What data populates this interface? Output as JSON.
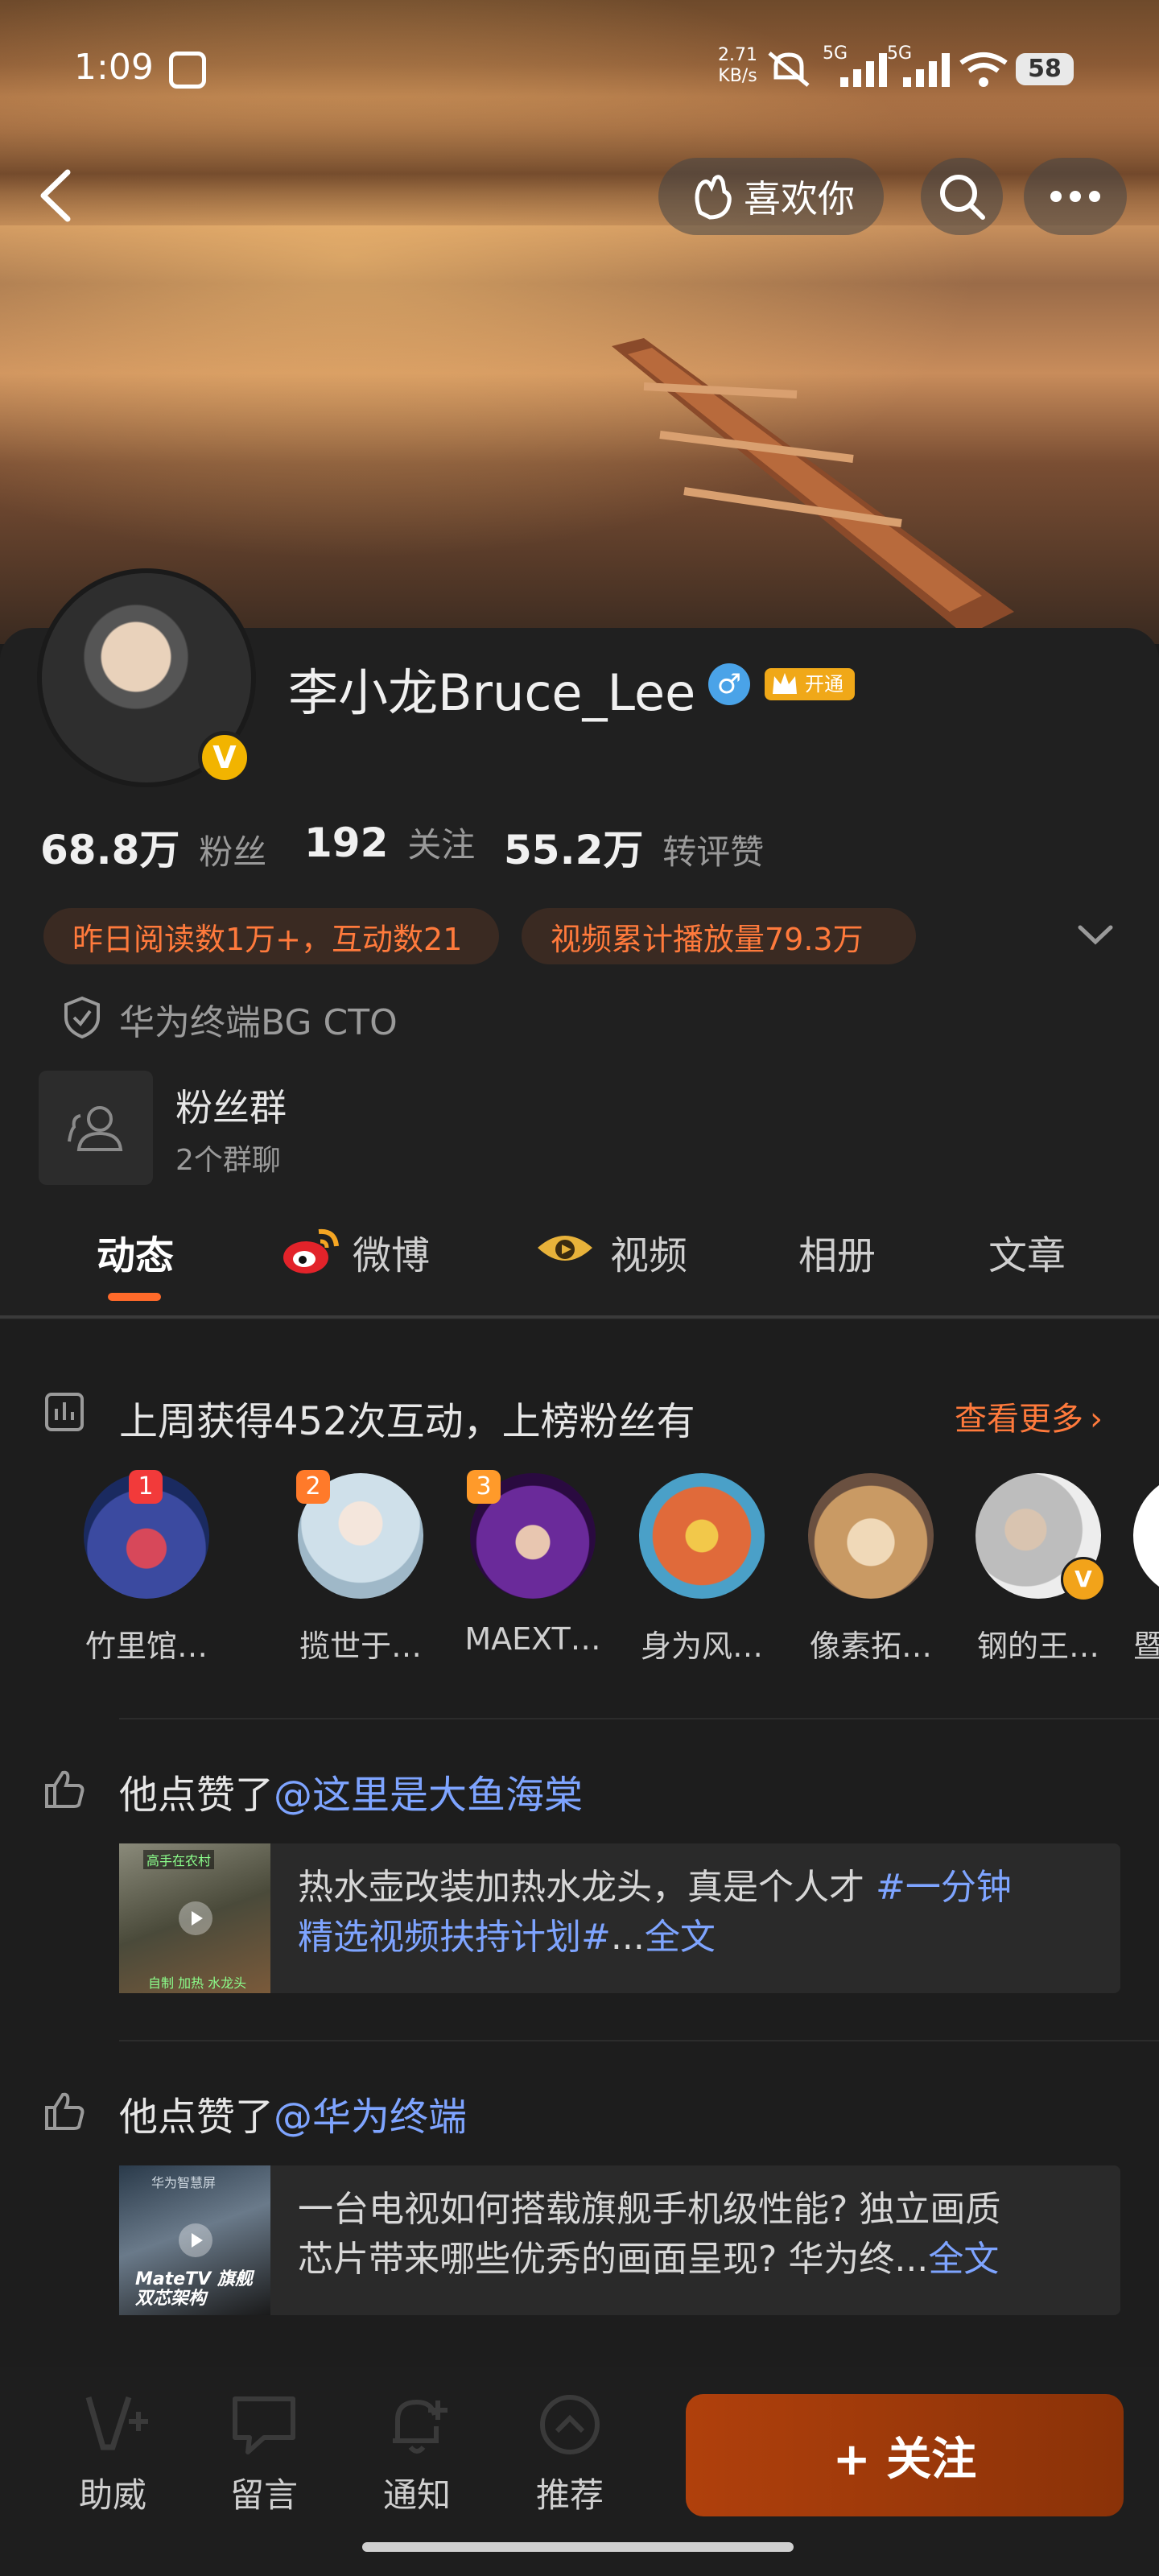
{
  "status_bar": {
    "time": "1:09",
    "net_speed_value": "2.71",
    "net_speed_unit": "KB/s",
    "net1": "5G",
    "net2": "5G",
    "battery": "58"
  },
  "top_actions": {
    "like_label": "喜欢你"
  },
  "profile": {
    "name": "李小龙Bruce_Lee",
    "vip_label": "开通",
    "stats": [
      {
        "value": "68.8万",
        "label": "粉丝"
      },
      {
        "value": "192",
        "label": "关注"
      },
      {
        "value": "55.2万",
        "label": "转评赞"
      }
    ],
    "chips": [
      "昨日阅读数1万+，互动数21",
      "视频累计播放量79.3万"
    ],
    "verification": "华为终端BG CTO",
    "group": {
      "title": "粉丝群",
      "subtitle": "2个群聊"
    }
  },
  "tabs": [
    "动态",
    "微博",
    "视频",
    "相册",
    "文章"
  ],
  "interaction": {
    "title": "上周获得452次互动，上榜粉丝有",
    "more": "查看更多",
    "fans": [
      {
        "name": "竹里馆…",
        "rank": "1",
        "color": "#6a7bd0"
      },
      {
        "name": "揽世于…",
        "rank": "2",
        "color": "#d9e7ee"
      },
      {
        "name": "MAEXT…",
        "rank": "3",
        "color": "#5a2a7a"
      },
      {
        "name": "身为风…",
        "rank": "",
        "color": "#e07a4a"
      },
      {
        "name": "像素拓…",
        "rank": "",
        "color": "#c89b6a"
      },
      {
        "name": "钢的王…",
        "rank": "",
        "color": "#cfcfcf"
      },
      {
        "name": "暨",
        "rank": "",
        "color": "#ffffff"
      }
    ]
  },
  "posts": [
    {
      "prefix": "他点赞了",
      "mention": "@这里是大鱼海棠",
      "line1": "热水壶改装加热水龙头，真是个人才 ",
      "line1_link": "#一分钟",
      "line2_link": "精选视频扶持计划#",
      "line2_rest": "...",
      "full": "全文",
      "thumb_top": "高手在农村",
      "thumb_bottom": "自制 加热 水龙头"
    },
    {
      "prefix": "他点赞了",
      "mention": "@华为终端",
      "line1": "一台电视如何搭载旗舰手机级性能? 独立画质",
      "line2_rest": "芯片带来哪些优秀的画面呈现? 华为终...",
      "full": "全文",
      "thumb_top": "华为智慧屏",
      "thumb_bottom": "MateTV 旗舰双芯架构"
    }
  ],
  "bottom_bar": {
    "items": [
      "助威",
      "留言",
      "通知",
      "推荐"
    ],
    "follow": "+ 关注"
  },
  "colors": {
    "accent_orange": "#ff7a3c",
    "link_blue": "#7ea4ff",
    "follow_bg": "#a53c0b"
  }
}
